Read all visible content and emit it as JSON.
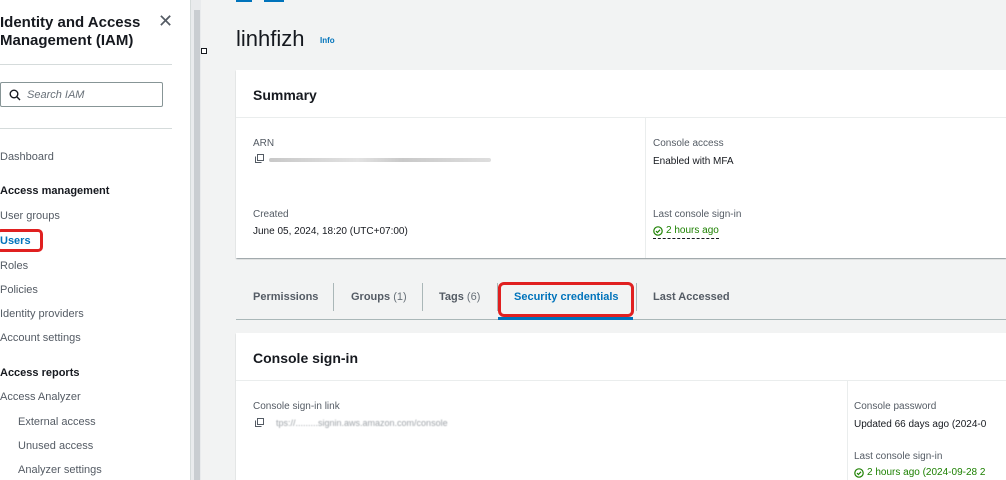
{
  "sidebar": {
    "title": "Identity and Access Management (IAM)",
    "close_label": "✕",
    "search_placeholder": "Search IAM",
    "items": {
      "dashboard": "Dashboard",
      "access_management": "Access management",
      "user_groups": "User groups",
      "users": "Users",
      "roles": "Roles",
      "policies": "Policies",
      "identity_providers": "Identity providers",
      "account_settings": "Account settings",
      "access_reports": "Access reports",
      "access_analyzer": "Access Analyzer",
      "external_access": "External access",
      "unused_access": "Unused access",
      "analyzer_settings": "Analyzer settings"
    },
    "active_item": "users"
  },
  "page": {
    "title": "linhfizh",
    "info": "Info"
  },
  "summary": {
    "title": "Summary",
    "arn_label": "ARN",
    "console_access_label": "Console access",
    "console_access_value": "Enabled with MFA",
    "created_label": "Created",
    "created_value": "June 05, 2024, 18:20 (UTC+07:00)",
    "last_signin_label": "Last console sign-in",
    "last_signin_value": "2 hours ago"
  },
  "tabs": [
    {
      "label": "Permissions",
      "count": ""
    },
    {
      "label": "Groups",
      "count": "(1)"
    },
    {
      "label": "Tags",
      "count": "(6)"
    },
    {
      "label": "Security credentials",
      "count": ""
    },
    {
      "label": "Last Accessed",
      "count": ""
    }
  ],
  "active_tab": "Security credentials",
  "console_signin": {
    "title": "Console sign-in",
    "link_label": "Console sign-in link",
    "link_value_visible": "tps://.........signin.aws.amazon.com/console",
    "password_label": "Console password",
    "password_value": "Updated 66 days ago (2024-0",
    "last_signin_label": "Last console sign-in",
    "last_signin_value": "2 hours ago (2024-09-28 2"
  },
  "colors": {
    "link": "#0073bb",
    "success": "#1d8102",
    "highlight": "#e02020"
  }
}
